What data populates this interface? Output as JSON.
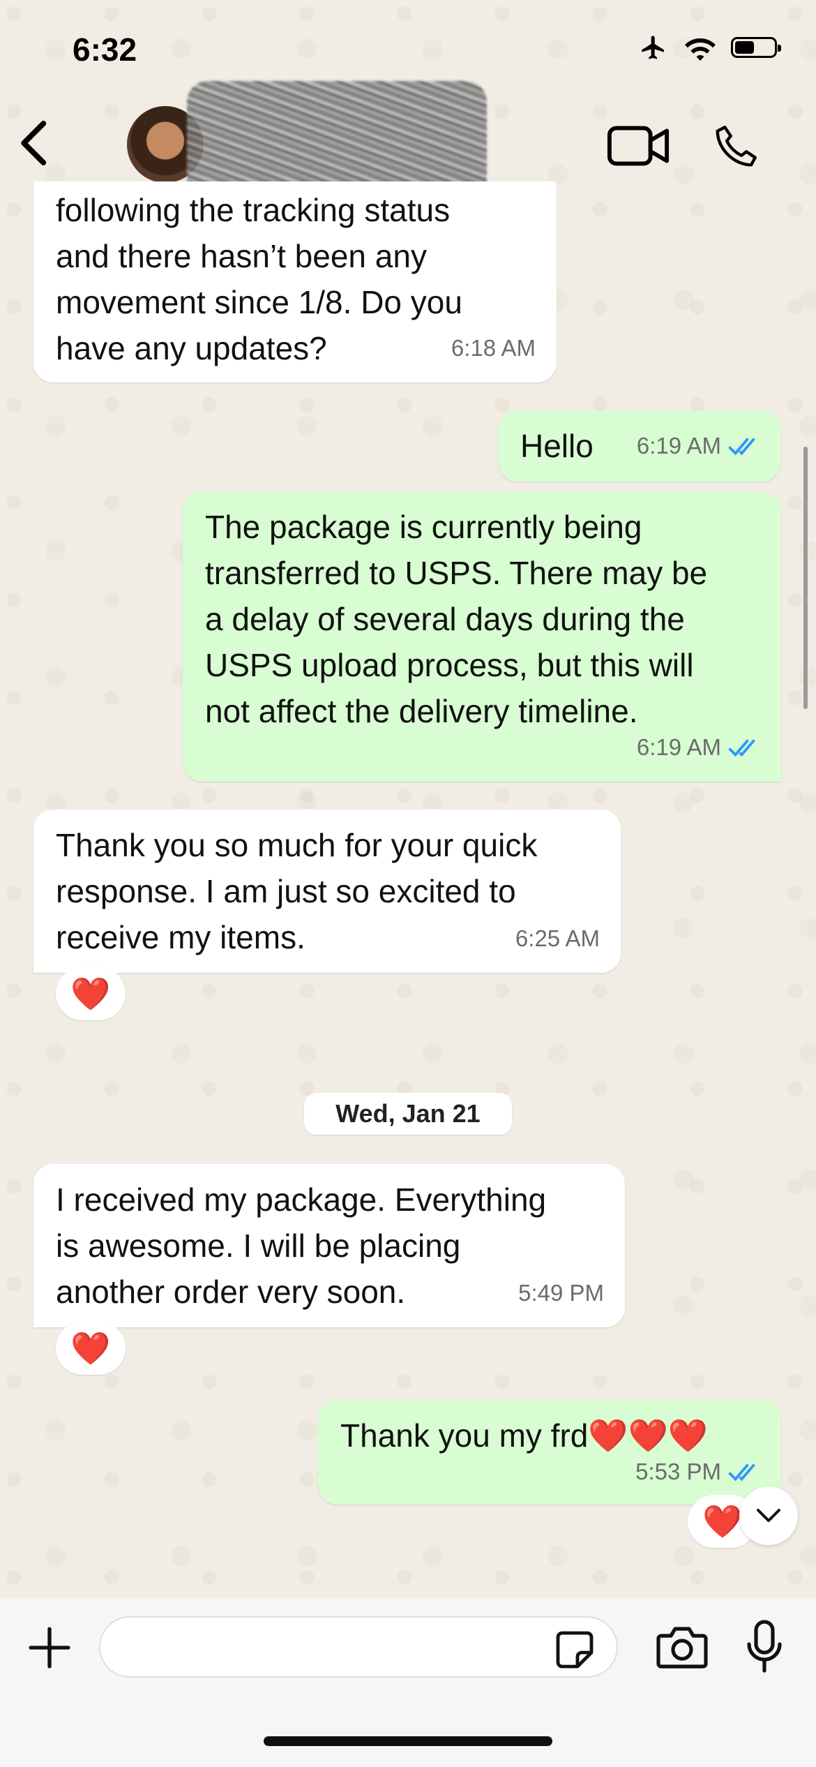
{
  "status_bar": {
    "time": "6:32",
    "battery_level": 0.5
  },
  "header": {
    "contact_name": "",
    "back_icon": "chevron-left-icon",
    "video_icon": "video-camera-icon",
    "call_icon": "phone-icon"
  },
  "messages": [
    {
      "text": "following the tracking status\nand there hasn’t been any\nmovement since 1/8. Do you\nhave any updates?",
      "time": "6:18 AM"
    },
    {
      "text": "Hello",
      "time": "6:19 AM"
    },
    {
      "text": "The package is currently being\ntransferred to USPS. There may be\na delay of several days during the\nUSPS upload process, but this will\nnot affect the delivery timeline.",
      "time": "6:19 AM"
    },
    {
      "text": "Thank you so much for your quick\nresponse. I am just so excited to\nreceive my items.",
      "time": "6:25 AM",
      "reaction": "❤️"
    },
    {
      "text": "I received my package. Everything\nis awesome. I will be placing\nanother order very soon.",
      "time": "5:49 PM",
      "reaction": "❤️"
    },
    {
      "text": "Thank you my frd❤️❤️❤️",
      "time": "5:53 PM",
      "reaction": "❤️"
    }
  ],
  "date_separator": "Wed, Jan 21",
  "composer": {
    "placeholder": ""
  },
  "colors": {
    "incoming": "#ffffff",
    "outgoing": "#d8fdd2",
    "read_ticks": "#3497f9"
  }
}
